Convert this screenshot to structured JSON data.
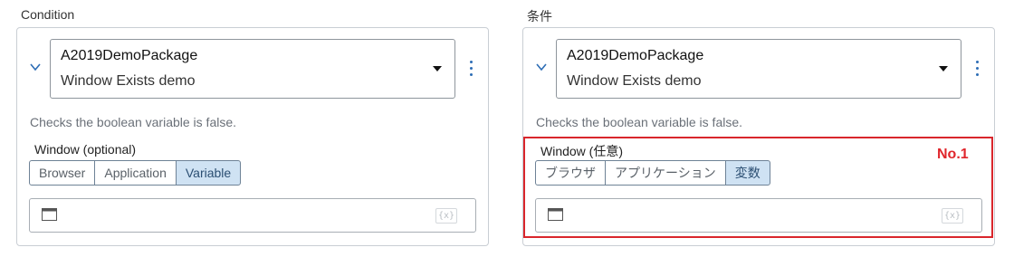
{
  "panels": [
    {
      "heading": "Condition",
      "package_name": "A2019DemoPackage",
      "action_name": "Window Exists demo",
      "description": "Checks the boolean variable is false.",
      "window_label": "Window (optional)",
      "options": [
        "Browser",
        "Application",
        "Variable"
      ],
      "selected_option": "Variable",
      "variable_icon_text": "{x}"
    },
    {
      "heading": "条件",
      "package_name": "A2019DemoPackage",
      "action_name": "Window Exists demo",
      "description": "Checks the boolean variable is false.",
      "window_label": "Window (任意)",
      "options": [
        "ブラウザ",
        "アプリケーション",
        "変数"
      ],
      "selected_option": "変数",
      "variable_icon_text": "{x}"
    }
  ],
  "annotation": {
    "label": "No.1",
    "color": "#e0262c"
  },
  "colors": {
    "selected_bg": "#cfe2f3",
    "accent": "#2d6db5",
    "highlight": "#d9262c"
  }
}
